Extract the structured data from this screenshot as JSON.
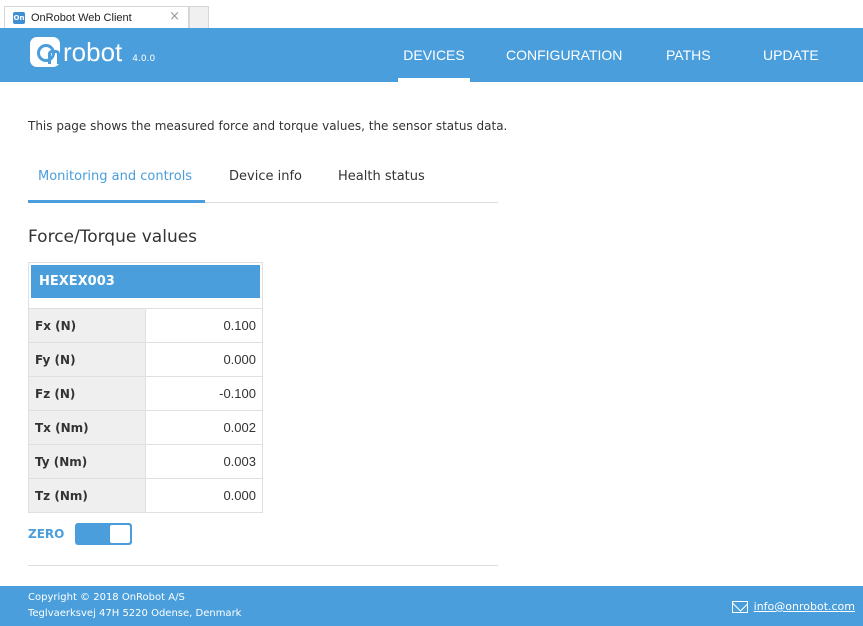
{
  "browser": {
    "tab_title": "OnRobot Web Client",
    "tab_close": "×"
  },
  "header": {
    "logo_text": "robot",
    "version": "4.0.0",
    "nav": [
      {
        "label": "DEVICES",
        "active": true
      },
      {
        "label": "CONFIGURATION",
        "active": false
      },
      {
        "label": "PATHS",
        "active": false
      },
      {
        "label": "UPDATE",
        "active": false
      }
    ]
  },
  "main": {
    "intro": "This page shows the measured force and torque values, the sensor status data.",
    "tabs": [
      {
        "label": "Monitoring and controls",
        "active": true
      },
      {
        "label": "Device info",
        "active": false
      },
      {
        "label": "Health status",
        "active": false
      }
    ],
    "section_title": "Force/Torque values",
    "device_name": "HEXEX003",
    "rows": [
      {
        "label": "Fx (N)",
        "value": "0.100"
      },
      {
        "label": "Fy (N)",
        "value": "0.000"
      },
      {
        "label": "Fz (N)",
        "value": "-0.100"
      },
      {
        "label": "Tx (Nm)",
        "value": "0.002"
      },
      {
        "label": "Ty (Nm)",
        "value": "0.003"
      },
      {
        "label": "Tz (Nm)",
        "value": "0.000"
      }
    ],
    "zero_label": "ZERO",
    "zero_on": true
  },
  "footer": {
    "copyright": "Copyright © 2018 OnRobot A/S",
    "address": "Teglvaerksvej 47H 5220 Odense, Denmark",
    "email": "info@onrobot.com"
  },
  "colors": {
    "accent": "#4a9edc"
  }
}
